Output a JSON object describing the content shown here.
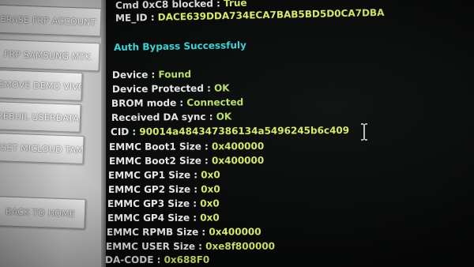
{
  "sidebar": {
    "buttons": [
      {
        "label": "ERASE FRP ACCOUNT"
      },
      {
        "label": "FRP SAMSUNG MTK"
      },
      {
        "label": "REMOVE DEMO VIVO"
      },
      {
        "label": "REBUIL USERDATA"
      },
      {
        "label": "ESET MICLOUD TAM"
      },
      {
        "label": "BACK TO HOME"
      }
    ]
  },
  "log": {
    "cmd_label": "Cmd 0xC8 blocked :",
    "cmd_value": "True",
    "meid_label": "ME_ID :",
    "meid_value": "DACE639DDA734ECA7BAB5BD5D0CA7DBA",
    "auth_bypass": "Auth Bypass Successfuly",
    "device_label": "Device :",
    "device_value": "Found",
    "protected_label": "Device Protected :",
    "protected_value": "OK",
    "brom_label": "BROM mode :",
    "brom_value": "Connected",
    "da_sync_label": "Received DA sync :",
    "da_sync_value": "OK",
    "cid_label": "CID :",
    "cid_value": "90014a484347386134a5496245b6c409",
    "boot1_label": "EMMC Boot1 Size :",
    "boot1_value": "0x400000",
    "boot2_label": "EMMC Boot2 Size :",
    "boot2_value": "0x400000",
    "gp1_label": "EMMC GP1 Size :",
    "gp1_value": "0x0",
    "gp2_label": "EMMC GP2 Size :",
    "gp2_value": "0x0",
    "gp3_label": "EMMC GP3 Size :",
    "gp3_value": "0x0",
    "gp4_label": "EMMC GP4 Size :",
    "gp4_value": "0x0",
    "rpmb_label": "EMMC RPMB Size :",
    "rpmb_value": "0x400000",
    "user_label": "EMMC USER Size :",
    "user_value": "0xe8f800000",
    "dacode_label": "DA-CODE :",
    "dacode_value": "0x688F0"
  },
  "colors": {
    "label": "#e6e6e6",
    "value_yellow": "#d9e86a",
    "value_green": "#b9e06a",
    "value_cyan": "#3fd2d6",
    "background": "#0b0d0c",
    "sidebar": "#cfcfcf"
  },
  "cursor": {
    "icon": "text-cursor-icon"
  }
}
